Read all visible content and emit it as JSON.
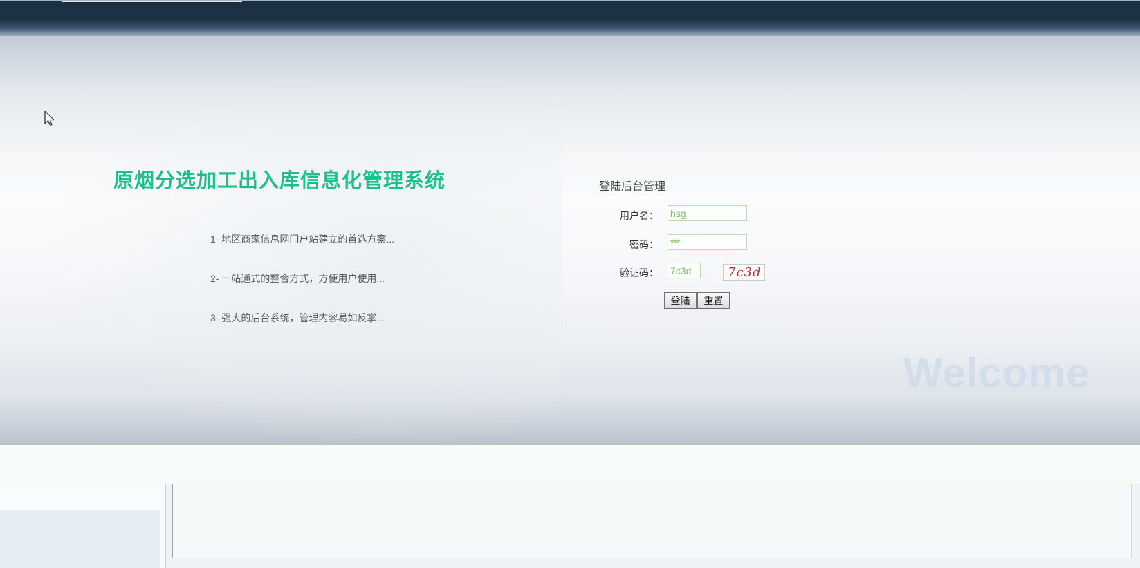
{
  "system": {
    "title": "原烟分选加工出入库信息化管理系统"
  },
  "features": [
    "1- 地区商家信息网门户站建立的首选方案...",
    "2- 一站通式的整合方式，方便用户使用...",
    "3- 强大的后台系统，管理内容易如反掌..."
  ],
  "login": {
    "title": "登陆后台管理",
    "username_label": "用户名：",
    "username_value": "hsg",
    "password_label": "密码：",
    "password_value": "***",
    "captcha_label": "验证码：",
    "captcha_value": "7c3d",
    "captcha_image_text": "7c3d",
    "login_button": "登陆",
    "reset_button": "重置"
  },
  "decor": {
    "welcome_text": "Welcome"
  },
  "colors": {
    "title_green": "#1cc08a",
    "top_bar": "#1a2e40",
    "input_border": "#b7dcae",
    "input_text": "#7dbd6a",
    "captcha_red": "#b0303a"
  }
}
